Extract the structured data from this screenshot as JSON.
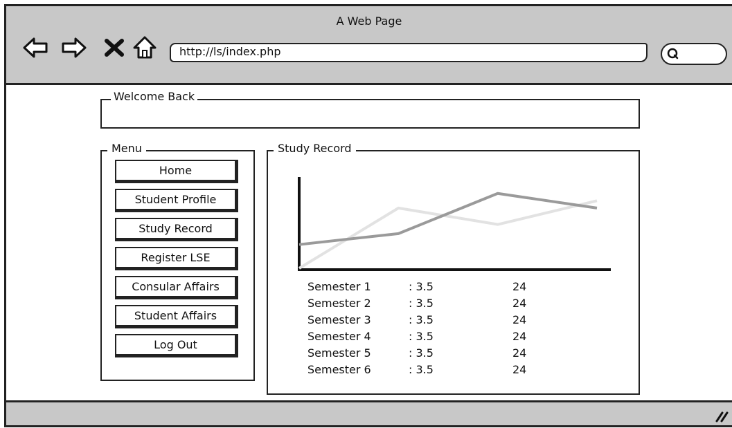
{
  "window": {
    "title": "A Web Page"
  },
  "browser": {
    "url": "http://ls/index.php",
    "nav_icons": [
      "back-icon",
      "forward-icon",
      "close-icon",
      "home-icon"
    ],
    "search_icon": "search-icon"
  },
  "welcome": {
    "label": "Welcome Back"
  },
  "menu": {
    "label": "Menu",
    "items": [
      {
        "label": "Home"
      },
      {
        "label": "Student Profile"
      },
      {
        "label": "Study Record"
      },
      {
        "label": "Register LSE"
      },
      {
        "label": "Consular Affairs"
      },
      {
        "label": "Student Affairs"
      },
      {
        "label": "Log Out"
      }
    ]
  },
  "study_record": {
    "label": "Study Record",
    "rows": [
      {
        "semester": "Semester 1",
        "gpa": ": 3.5",
        "credits": "24"
      },
      {
        "semester": "Semester 2",
        "gpa": ": 3.5",
        "credits": "24"
      },
      {
        "semester": "Semester 3",
        "gpa": ": 3.5",
        "credits": "24"
      },
      {
        "semester": "Semester 4",
        "gpa": ": 3.5",
        "credits": "24"
      },
      {
        "semester": "Semester 5",
        "gpa": ": 3.5",
        "credits": "24"
      },
      {
        "semester": "Semester 6",
        "gpa": ": 3.5",
        "credits": "24"
      }
    ]
  },
  "chart_data": {
    "type": "line",
    "title": "",
    "xlabel": "",
    "ylabel": "",
    "x": [
      0,
      1,
      2,
      3
    ],
    "xlim": [
      0,
      3
    ],
    "ylim": [
      0,
      1
    ],
    "grid": false,
    "series": [
      {
        "values": [
          0.26,
          0.38,
          0.82,
          0.66
        ],
        "color": "#9a9a9a"
      },
      {
        "values": [
          0.0,
          0.66,
          0.48,
          0.74
        ],
        "color": "#e2e2e2"
      }
    ]
  },
  "colors": {
    "chrome": "#c8c8c8",
    "ink": "#222222"
  }
}
